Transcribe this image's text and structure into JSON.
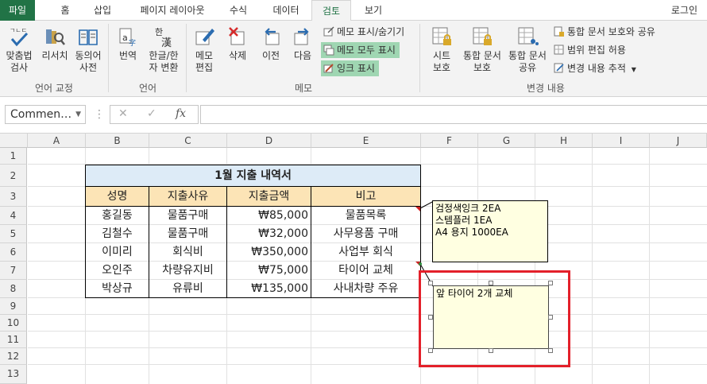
{
  "tabs": [
    "파일",
    "홈",
    "삽입",
    "페이지 레이아웃",
    "수식",
    "데이터",
    "검토",
    "보기"
  ],
  "login": "로그인",
  "ribbon": {
    "language_tools": {
      "label": "언어 교정",
      "spell": "맞춤법\n검사",
      "thesaurus": "리서치",
      "synonym": "동의어\n사전"
    },
    "language": {
      "label": "언어",
      "translate": "번역",
      "hangul_hanja": "한글/한\n자 변환"
    },
    "memo": {
      "label": "메모",
      "new": "메모\n편집",
      "delete": "삭제",
      "prev": "이전",
      "next": "다음",
      "show_hide": "메모 표시/숨기기",
      "show_all": "메모 모두 표시",
      "show_ink": "잉크 표시"
    },
    "changes": {
      "label": "변경 내용",
      "protect_sheet": "시트\n보호",
      "protect_workbook": "통합 문서\n보호",
      "share_workbook": "통합 문서\n공유",
      "protect_share": "통합 문서 보호와 공유",
      "allow_edit": "범위 편집 허용",
      "track": "변경 내용 추적"
    }
  },
  "formula_bar": {
    "name_box": "Commen…",
    "fx": "fx"
  },
  "columns": [
    "A",
    "B",
    "C",
    "D",
    "E",
    "F",
    "G",
    "H",
    "I",
    "J"
  ],
  "rows": [
    "1",
    "2",
    "3",
    "4",
    "5",
    "6",
    "7",
    "8",
    "9",
    "10",
    "11",
    "12",
    "13"
  ],
  "table": {
    "title": "1월 지출 내역서",
    "headers": [
      "성명",
      "지출사유",
      "지출금액",
      "비고"
    ],
    "rows": [
      [
        "홍길동",
        "물품구매",
        "₩85,000",
        "물품목록"
      ],
      [
        "김철수",
        "물품구매",
        "₩32,000",
        "사무용품 구매"
      ],
      [
        "이미리",
        "회식비",
        "₩350,000",
        "사업부 회식"
      ],
      [
        "오인주",
        "차량유지비",
        "₩75,000",
        "타이어 교체"
      ],
      [
        "박상규",
        "유류비",
        "₩135,000",
        "사내차량 주유"
      ]
    ]
  },
  "comments": {
    "first": [
      "검정색잉크 2EA",
      "스템플러 1EA",
      "A4 용지 1000EA"
    ],
    "second": "앞 타이어 2개 교체"
  },
  "colors": {
    "accent": "#217346",
    "header_fill": "#fce4b6",
    "title_fill": "#ddebf7",
    "highlight": "#e3202a",
    "comment_fill": "#ffffe1"
  }
}
